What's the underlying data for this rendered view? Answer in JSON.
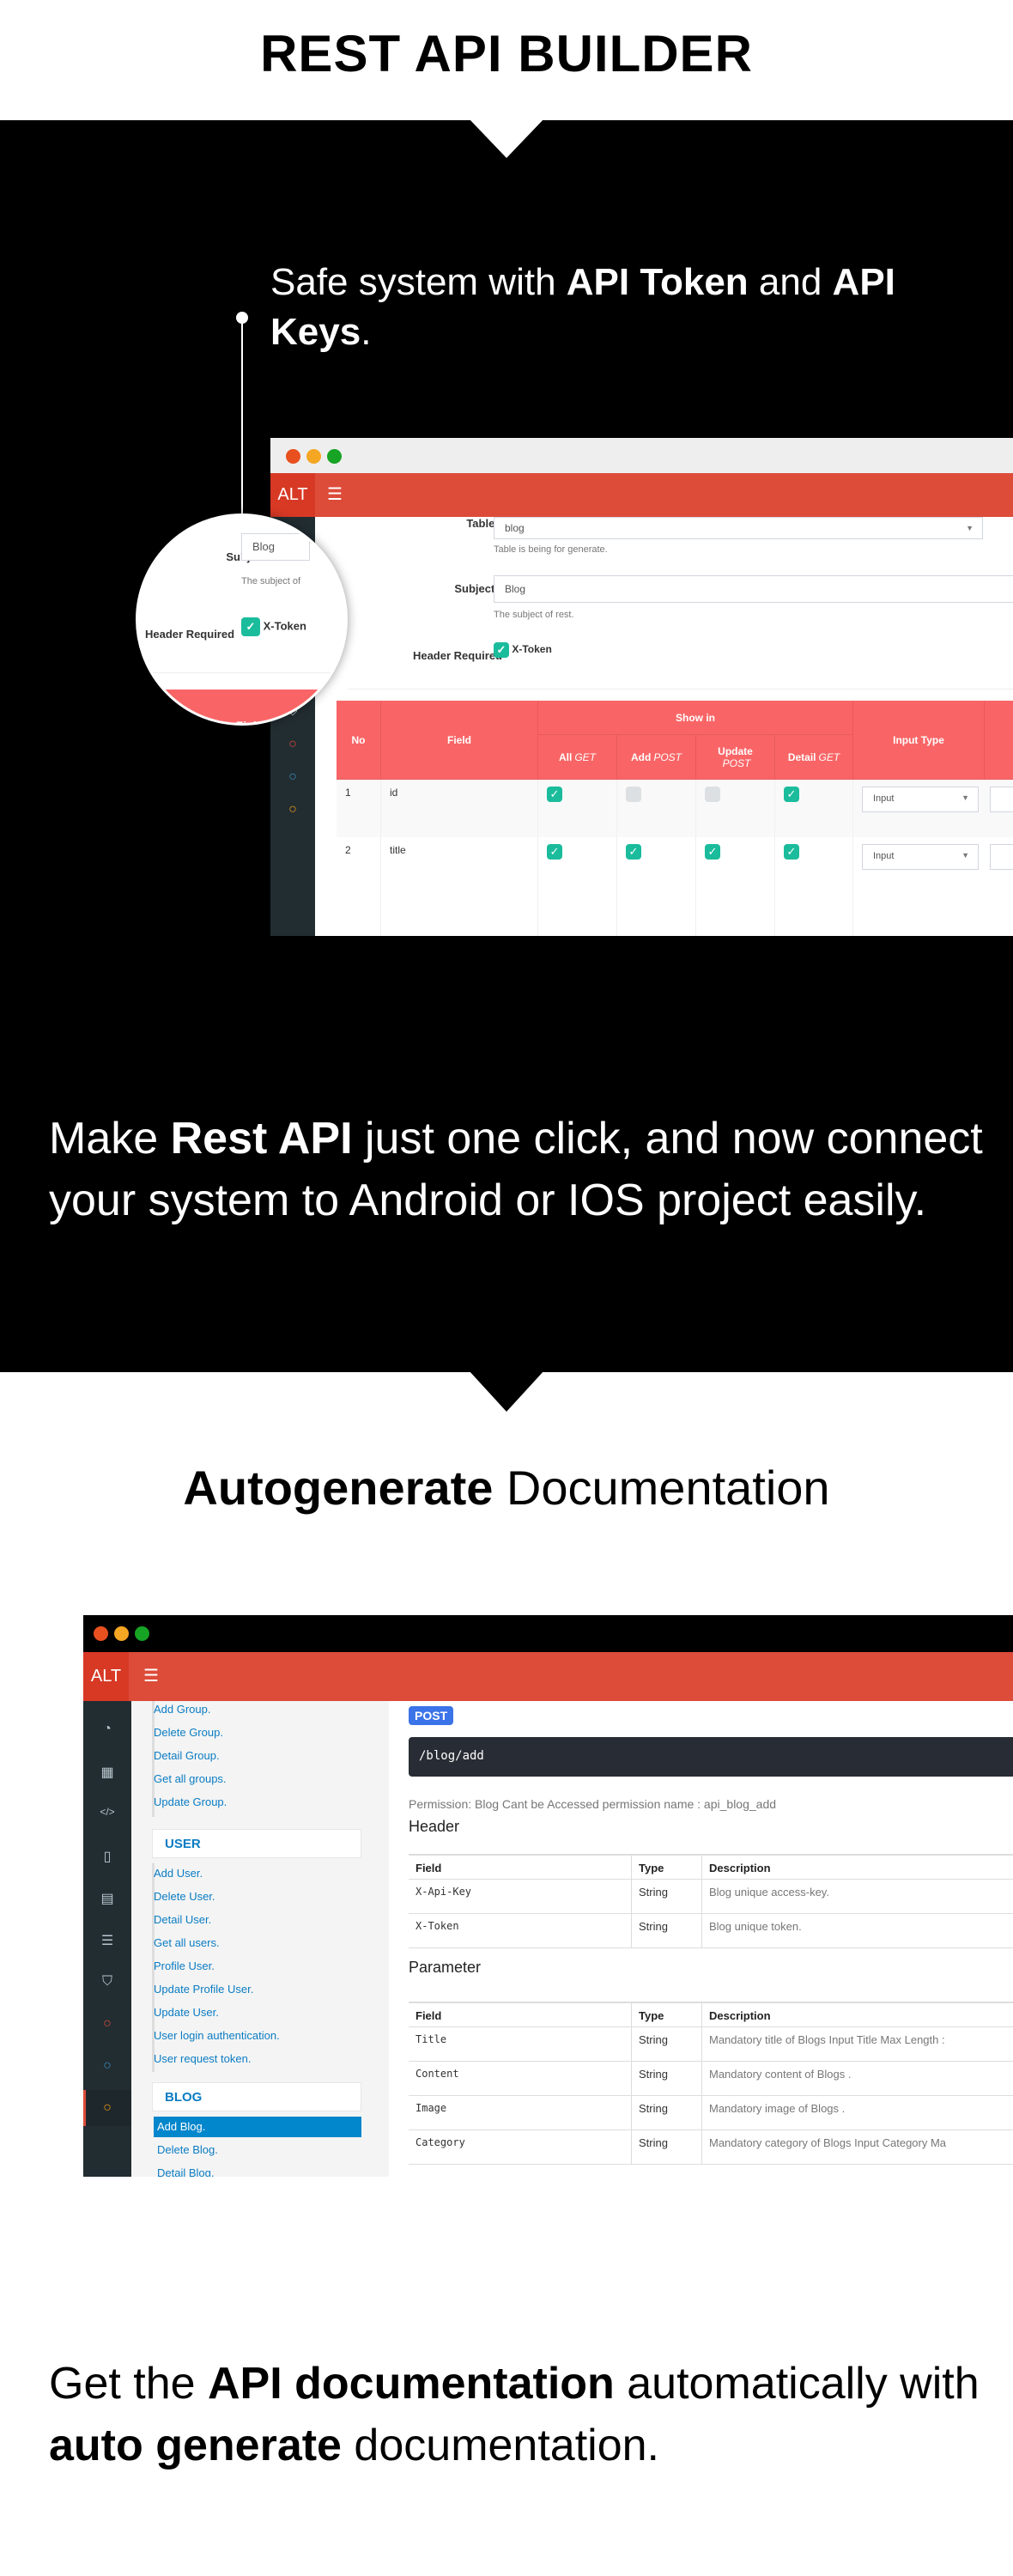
{
  "title": "REST API BUILDER",
  "section1": {
    "text_before": "Safe system with ",
    "bold1": "API Token",
    "text_mid": " and ",
    "bold2": "API Keys",
    "text_end": "."
  },
  "section2": {
    "text_before": "Make ",
    "bold": "Rest API",
    "text_after": "  just one click, and now connect your system to Android or IOS project easily."
  },
  "section3": {
    "bold": "Autogenerate",
    "text": " Documentation"
  },
  "section4": {
    "text1": "Get the ",
    "bold1": "API documentation",
    "text2": " automatically with ",
    "bold2": "auto generate",
    "text3": " documentation."
  },
  "colors": {
    "header_red": "#dd4b39",
    "table_header": "#f96566",
    "check_teal": "#1abc9c",
    "sidebar_dark": "#222d32",
    "link_blue": "#0a7cc3",
    "post_badge": "#3b73e8"
  },
  "app": {
    "logo": "ALT",
    "menu_icon": "hamburger-icon"
  },
  "builder": {
    "table_label": "Table",
    "table_value": "blog",
    "table_help": "Table is being for generate.",
    "subject_label": "Subject",
    "subject_value": "Blog",
    "subject_help": "The subject of rest.",
    "subject_help_cut": "The subject of",
    "header_required_label": "Header Required",
    "xtoken_label": "X-Token",
    "xtoken_checked": true,
    "columns": {
      "no": "No",
      "field": "Field",
      "show_in": "Show in",
      "all": "All",
      "get": "GET",
      "add": "Add",
      "post": "POST",
      "update": "Update",
      "detail": "Detail",
      "input_type": "Input Type"
    },
    "rows": [
      {
        "no": "1",
        "field": "id",
        "all_get": true,
        "add_post": false,
        "update_post": false,
        "detail_get": true,
        "input_type": "Input"
      },
      {
        "no": "2",
        "field": "title",
        "all_get": true,
        "add_post": true,
        "update_post": true,
        "detail_get": true,
        "input_type": "Input"
      }
    ]
  },
  "docs": {
    "menu_group_items": [
      "Add Group.",
      "Delete Group.",
      "Detail Group.",
      "Get all groups.",
      "Update Group."
    ],
    "menu_user_heading": "USER",
    "menu_user_items": [
      "Add User.",
      "Delete User.",
      "Detail User.",
      "Get all users.",
      "Profile User.",
      "Update Profile User.",
      "Update User.",
      "User login authentication.",
      "User request token."
    ],
    "menu_blog_heading": "BLOG",
    "menu_blog_items": [
      "Add Blog.",
      "Delete Blog.",
      "Detail Blog."
    ],
    "active_item": "Add Blog.",
    "method": "POST",
    "endpoint": "/blog/add",
    "permission": "Permission: Blog Cant be Accessed permission name : api_blog_add",
    "header_title": "Header",
    "parameter_title": "Parameter",
    "col_field": "Field",
    "col_type": "Type",
    "col_desc": "Description",
    "header_rows": [
      {
        "field": "X-Api-Key",
        "type": "String",
        "desc": "Blog unique access-key."
      },
      {
        "field": "X-Token",
        "type": "String",
        "desc": "Blog unique token."
      }
    ],
    "param_rows": [
      {
        "field": "Title",
        "type": "String",
        "desc": "Mandatory title of Blogs Input Title Max Length :"
      },
      {
        "field": "Content",
        "type": "String",
        "desc": "Mandatory content of Blogs ."
      },
      {
        "field": "Image",
        "type": "String",
        "desc": "Mandatory image of Blogs ."
      },
      {
        "field": "Category",
        "type": "String",
        "desc": "Mandatory category of Blogs Input Category Ma"
      }
    ],
    "sidebar_icons": [
      "dashboard-icon",
      "table-icon",
      "code-icon",
      "file-icon",
      "newspaper-icon",
      "list-icon",
      "shield-icon",
      "circle-red-icon",
      "circle-blue-icon",
      "circle-yellow-icon"
    ]
  }
}
